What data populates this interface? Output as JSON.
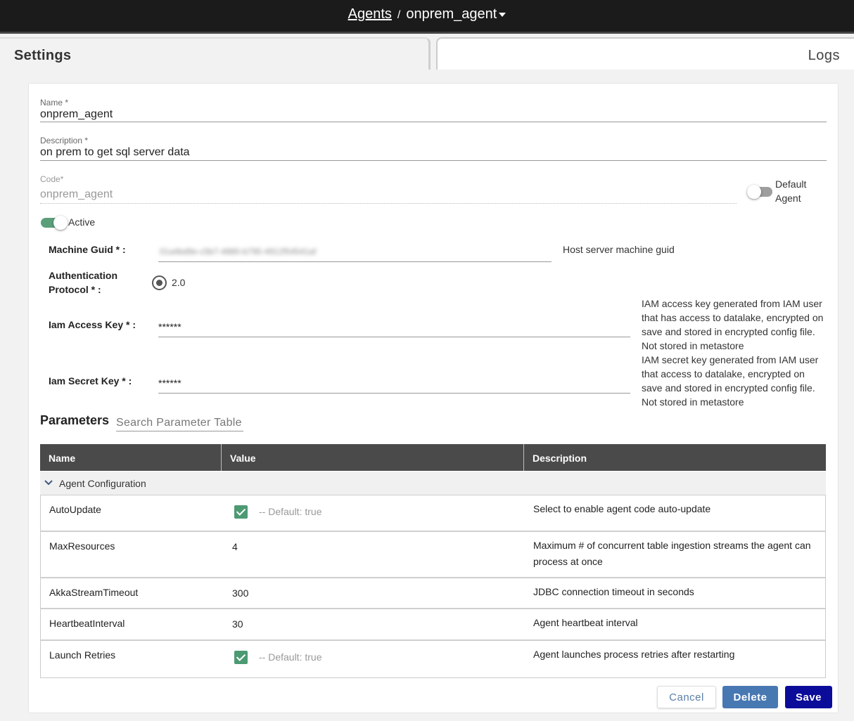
{
  "breadcrumb": {
    "root": "Agents",
    "separator": "/",
    "current": "onprem_agent"
  },
  "tabs": {
    "settings": "Settings",
    "logs": "Logs"
  },
  "form": {
    "name": {
      "label": "Name *",
      "value": "onprem_agent"
    },
    "description": {
      "label": "Description *",
      "value": "on prem to get sql server data"
    },
    "code": {
      "label": "Code*",
      "value": "onprem_agent"
    },
    "default_agent": {
      "label_line1": "Default",
      "label_line2": "Agent",
      "enabled": false
    },
    "active": {
      "label": "Active",
      "enabled": true
    },
    "machine_guid": {
      "label": "Machine Guid * :",
      "value": "01a4bd9e-c5b7-4880-b795-4912f54541af",
      "help": "Host server machine guid"
    },
    "auth_protocol": {
      "label_line1": "Authentication",
      "label_line2": "Protocol * :",
      "option": "2.0",
      "selected": true
    },
    "iam_access_key": {
      "label": "Iam Access Key * :",
      "value": "******",
      "help": [
        "IAM access key generated from IAM user",
        "that has access to datalake, encrypted on",
        "save and stored in encrypted config file.",
        "Not stored in metastore"
      ]
    },
    "iam_secret_key": {
      "label": "Iam Secret Key * :",
      "value": "******",
      "help": [
        "IAM secret key generated from IAM user",
        "that access to datalake, encrypted on",
        "save and stored in encrypted config file.",
        "Not stored in metastore"
      ]
    }
  },
  "parameters": {
    "title": "Parameters",
    "search_placeholder": "Search Parameter Table",
    "columns": [
      "Name",
      "Value",
      "Description"
    ],
    "group": "Agent Configuration",
    "rows": [
      {
        "name": "AutoUpdate",
        "checked": true,
        "default_text": "-- Default: true",
        "description": "Select to enable agent code auto-update"
      },
      {
        "name": "MaxResources",
        "value": "4",
        "description": "Maximum # of concurrent table ingestion streams the agent can process at once"
      },
      {
        "name": "AkkaStreamTimeout",
        "value": "300",
        "description": "JDBC connection timeout in seconds"
      },
      {
        "name": "HeartbeatInterval",
        "value": "30",
        "description": "Agent heartbeat interval"
      },
      {
        "name": "Launch Retries",
        "checked": true,
        "default_text": "-- Default: true",
        "description": "Agent launches process retries after restarting"
      }
    ]
  },
  "actions": {
    "cancel": "Cancel",
    "delete": "Delete",
    "save": "Save"
  },
  "colors": {
    "topbar": "#1b1b1b",
    "toggle_on": "#5a9f7a",
    "checkbox": "#4c9a72",
    "delete_button": "#4778b2",
    "save_button": "#0c0c9a",
    "table_header": "#4a4a4a"
  }
}
